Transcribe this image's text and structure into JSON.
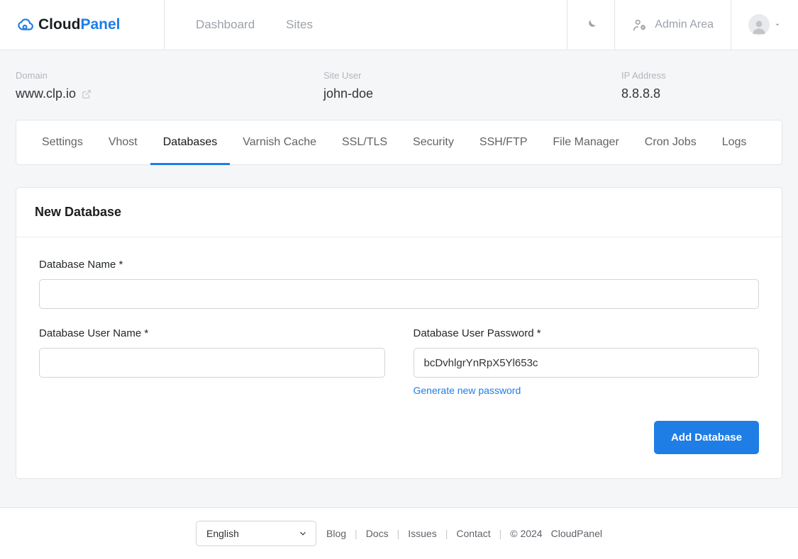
{
  "brand": {
    "part1": "Cloud",
    "part2": "Panel"
  },
  "nav": {
    "dashboard": "Dashboard",
    "sites": "Sites",
    "adminArea": "Admin Area"
  },
  "siteInfo": {
    "domainLabel": "Domain",
    "domainValue": "www.clp.io",
    "siteUserLabel": "Site User",
    "siteUserValue": "john-doe",
    "ipLabel": "IP Address",
    "ipValue": "8.8.8.8"
  },
  "tabs": {
    "settings": "Settings",
    "vhost": "Vhost",
    "databases": "Databases",
    "varnish": "Varnish Cache",
    "ssl": "SSL/TLS",
    "security": "Security",
    "ssh": "SSH/FTP",
    "fileManager": "File Manager",
    "cron": "Cron Jobs",
    "logs": "Logs"
  },
  "form": {
    "heading": "New Database",
    "dbNameLabel": "Database Name *",
    "dbUserLabel": "Database User Name *",
    "dbPasswordLabel": "Database User Password *",
    "passwordValue": "bcDvhlgrYnRpX5Yl653c",
    "generateLink": "Generate new password",
    "submit": "Add Database"
  },
  "footer": {
    "language": "English",
    "blog": "Blog",
    "docs": "Docs",
    "issues": "Issues",
    "contact": "Contact",
    "copyright": "© 2024",
    "name": "CloudPanel"
  }
}
